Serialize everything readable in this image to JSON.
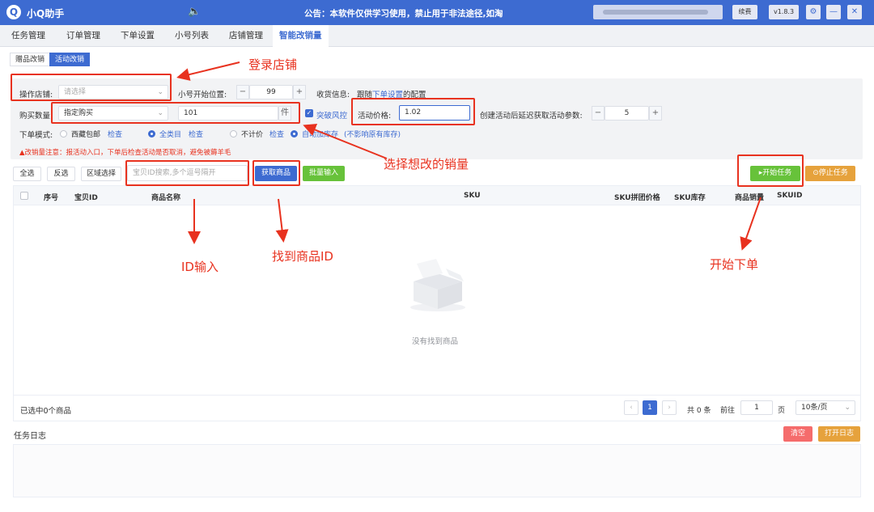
{
  "app": {
    "title": "小Q助手",
    "logo_letter": "Q",
    "notice": "公告：本软件仅供学习使用，禁止用于非法途径,如淘",
    "renew_label": "续费",
    "version": "v1.8.3"
  },
  "tabs": [
    "任务管理",
    "订单管理",
    "下单设置",
    "小号列表",
    "店铺管理",
    "智能改销量"
  ],
  "sub_tabs": [
    "赠品改销",
    "活动改销"
  ],
  "form": {
    "shop_label": "操作店铺:",
    "shop_placeholder": "请选择",
    "start_pos_label": "小号开始位置:",
    "start_pos_value": "99",
    "receive_label": "收货信息:",
    "receive_text_1": "跟随",
    "receive_link": "下单设置",
    "receive_text_2": "的配置",
    "qty_label": "购买数量",
    "qty_mode": "指定购买",
    "qty_value": "101",
    "qty_unit": "件",
    "risk_label": "突破风控",
    "price_label": "活动价格:",
    "price_value": "1.02",
    "delay_label": "创建活动后延迟获取活动参数:",
    "delay_value": "5",
    "mode_label": "下单模式:",
    "mode_options": [
      {
        "label": "西藏包邮",
        "link": "检查"
      },
      {
        "label": "全类目",
        "link": "检查"
      },
      {
        "label": "不计价",
        "link": "检查"
      },
      {
        "label": "自动加库存",
        "link": "(不影响原有库存)"
      }
    ],
    "warning": "▲改销量注意：报活动入口，下单后检查活动是否取消，避免被薅羊毛"
  },
  "toolbar": {
    "select_all": "全选",
    "invert": "反选",
    "range_select": "区域选择",
    "search_placeholder": "宝贝ID搜索,多个逗号隔开",
    "fetch_button": "获取商品",
    "batch_input": "批量输入",
    "start_task": "▸开始任务",
    "stop_task": "⊙停止任务"
  },
  "table": {
    "columns": [
      "序号",
      "宝贝ID",
      "商品名称",
      "SKU",
      "SKU拼团价格",
      "SKU库存",
      "商品销量",
      "SKUID"
    ],
    "empty_text": "没有找到商品",
    "selected_text": "已选中0个商品"
  },
  "pagination": {
    "current_page": "1",
    "total": "共 0 条",
    "goto_label": "前往",
    "goto_value": "1",
    "page_unit": "页",
    "page_size": "10条/页"
  },
  "log": {
    "title": "任务日志",
    "clear": "清空",
    "open": "打开日志"
  },
  "annotations": {
    "login_shop": "登录店铺",
    "choose_sales": "选择想改的销量",
    "id_input": "ID输入",
    "find_product": "找到商品ID",
    "start_order": "开始下单"
  },
  "colors": {
    "primary": "#3d6bd1",
    "annotation": "#e8321f",
    "success": "#67c23a",
    "warning": "#e6a23c",
    "danger": "#f56c6c"
  }
}
